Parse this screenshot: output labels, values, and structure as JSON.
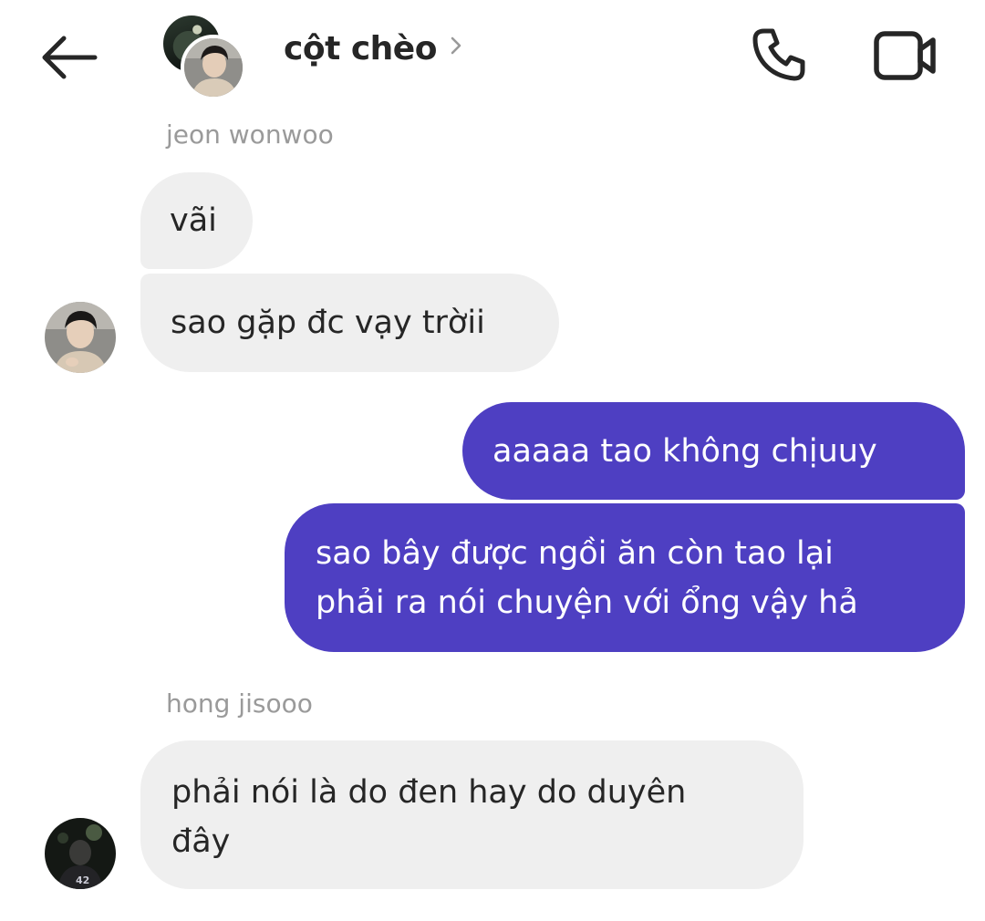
{
  "header": {
    "title": "cột chèo",
    "back_icon": "arrow-left-icon",
    "chevron_icon": "chevron-right-icon",
    "call_icon": "phone-icon",
    "video_icon": "video-camera-icon"
  },
  "colors": {
    "outgoing_bubble": "#4e3fc2",
    "incoming_bubble": "#efefef",
    "sender_label": "#9a9a9a",
    "text": "#262626"
  },
  "messages": [
    {
      "sender": "jeon wonwoo",
      "direction": "incoming",
      "bubbles": [
        "vãi",
        "sao gặp đc vạy trờii"
      ]
    },
    {
      "sender": "",
      "direction": "outgoing",
      "bubbles": [
        "aaaaa tao không chịuuy",
        "sao bây được ngồi ăn còn tao lại\nphải ra nói chuyện với ổng vậy hả"
      ]
    },
    {
      "sender": "hong jisooo",
      "direction": "incoming",
      "bubbles": [
        "phải nói là do đen hay do duyên\nđây"
      ]
    }
  ]
}
